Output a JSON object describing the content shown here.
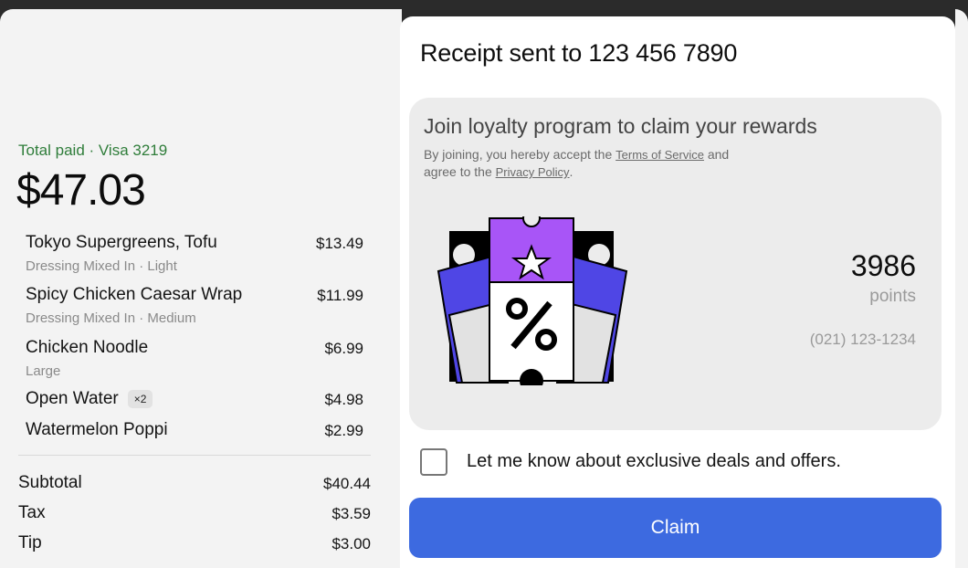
{
  "payment": {
    "paid_label": "Total paid · Visa 3219",
    "total": "$47.03"
  },
  "items": [
    {
      "name": "Tokyo Supergreens, Tofu",
      "modifier": "Dressing Mixed In · Light",
      "price": "$13.49",
      "qty": ""
    },
    {
      "name": "Spicy Chicken Caesar Wrap",
      "modifier": "Dressing Mixed In · Medium",
      "price": "$11.99",
      "qty": ""
    },
    {
      "name": "Chicken Noodle",
      "modifier": "Large",
      "price": "$6.99",
      "qty": ""
    },
    {
      "name": "Open Water",
      "modifier": "",
      "price": "$4.98",
      "qty": "×2"
    },
    {
      "name": "Watermelon Poppi",
      "modifier": "",
      "price": "$2.99",
      "qty": ""
    }
  ],
  "summary": {
    "subtotal_label": "Subtotal",
    "subtotal": "$40.44",
    "tax_label": "Tax",
    "tax": "$3.59",
    "tip_label": "Tip",
    "tip": "$3.00"
  },
  "receipt": {
    "title": "Receipt sent to 123 456 7890"
  },
  "loyalty": {
    "title": "Join loyalty program to claim your rewards",
    "sub_prefix": "By joining, you hereby accept the ",
    "terms_link": "Terms of Service",
    "sub_middle": " and agree to the ",
    "privacy_link": "Privacy Policy",
    "sub_suffix": ".",
    "points_value": "3986",
    "points_label": "points",
    "phone": "(021) 123-1234",
    "illustration_icon": "coupon-tickets-icon"
  },
  "offers": {
    "checkbox_label": "Let me know about exclusive deals and offers.",
    "checked": false
  },
  "actions": {
    "claim_label": "Claim"
  },
  "colors": {
    "accent": "#3d6ae0",
    "paid_green": "#2f7d3a",
    "ticket_purple": "#a855f7",
    "ticket_blue": "#4f46e5"
  }
}
